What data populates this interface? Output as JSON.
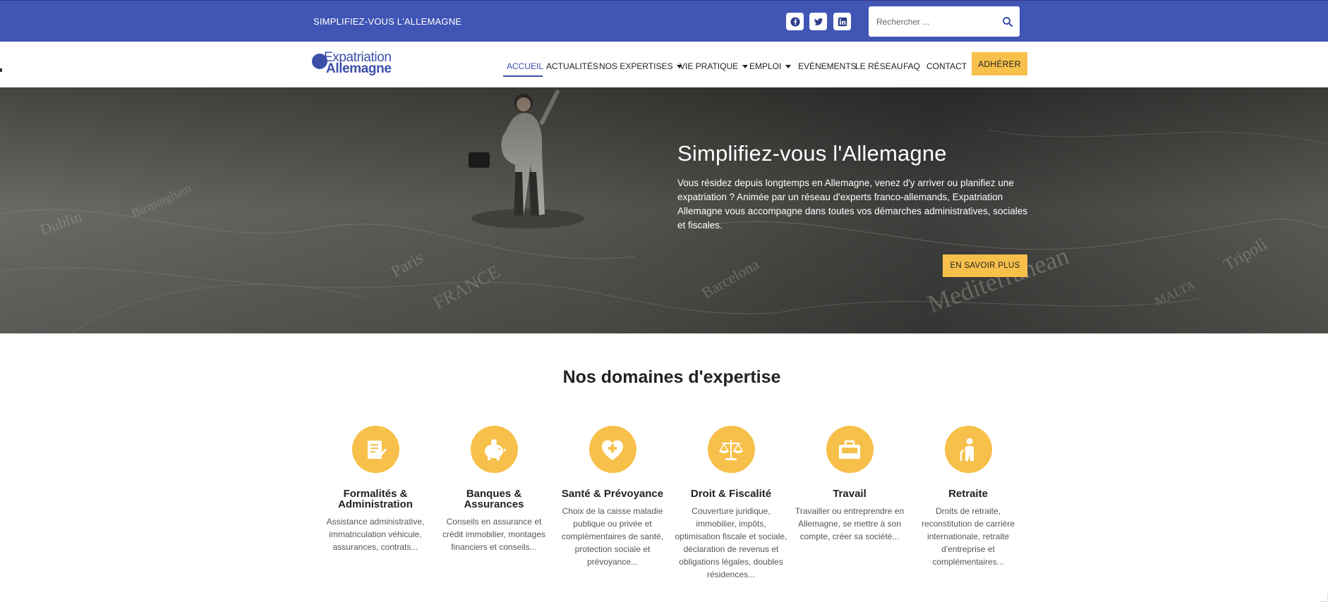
{
  "topbar": {
    "tagline": "SIMPLIFIEZ-VOUS L'ALLEMAGNE",
    "social": [
      "facebook-icon",
      "twitter-icon",
      "linkedin-icon"
    ],
    "search_placeholder": "Rechercher ..."
  },
  "logo": {
    "line1": "Expatriation",
    "line2": "Allemagne"
  },
  "nav": {
    "items": [
      {
        "label": "ACCUEIL",
        "active": true
      },
      {
        "label": "ACTUALITÉS"
      },
      {
        "label": "NOS EXPERTISES",
        "dropdown": true
      },
      {
        "label": "VIE PRATIQUE",
        "dropdown": true
      },
      {
        "label": "EMPLOI",
        "dropdown": true
      },
      {
        "label": "EVÈNEMENTS"
      },
      {
        "label": "LE RÉSEAU"
      },
      {
        "label": "FAQ"
      },
      {
        "label": "CONTACT"
      }
    ],
    "cta": "ADHÉRER"
  },
  "hero": {
    "title": "Simplifiez-vous l'Allemagne",
    "text": "Vous résidez depuis longtemps en Allemagne, venez d'y arriver ou planifiez une expatriation ? Animée par un réseau d'experts franco-allemands, Expatriation Allemagne vous accompagne dans toutes vos démarches administratives, sociales et fiscales.",
    "button": "EN SAVOIR PLUS"
  },
  "expertise": {
    "title": "Nos domaines d'expertise",
    "cards": [
      {
        "icon": "document-pen-icon",
        "title": "Formalités & Administration",
        "desc": "Assistance administrative, immatriculation véhicule, assurances, contrats..."
      },
      {
        "icon": "piggy-bank-icon",
        "title": "Banques & Assurances",
        "desc": "Conseils en assurance et crédit immobilier, montages financiers et conseils..."
      },
      {
        "icon": "heart-plus-icon",
        "title": "Santé & Prévoyance",
        "desc": "Choix de la caisse maladie publique ou privée et complémentaires de santé, protection sociale et prévoyance..."
      },
      {
        "icon": "scales-icon",
        "title": "Droit & Fiscalité",
        "desc": "Couverture juridique, immobilier, impôts, optimisation fiscale et sociale, déclaration de revenus et obligations légales, doubles résidences..."
      },
      {
        "icon": "briefcase-icon",
        "title": "Travail",
        "desc": "Travailler ou entreprendre en Allemagne, se mettre à son compte, créer sa société..."
      },
      {
        "icon": "elderly-person-icon",
        "title": "Retraite",
        "desc": "Droits de retraite, reconstitution de carrière internationale, retraite d'entreprise et complémentaires..."
      }
    ]
  },
  "colors": {
    "brand_blue": "#4155b5",
    "accent_yellow": "#f7c04a"
  }
}
